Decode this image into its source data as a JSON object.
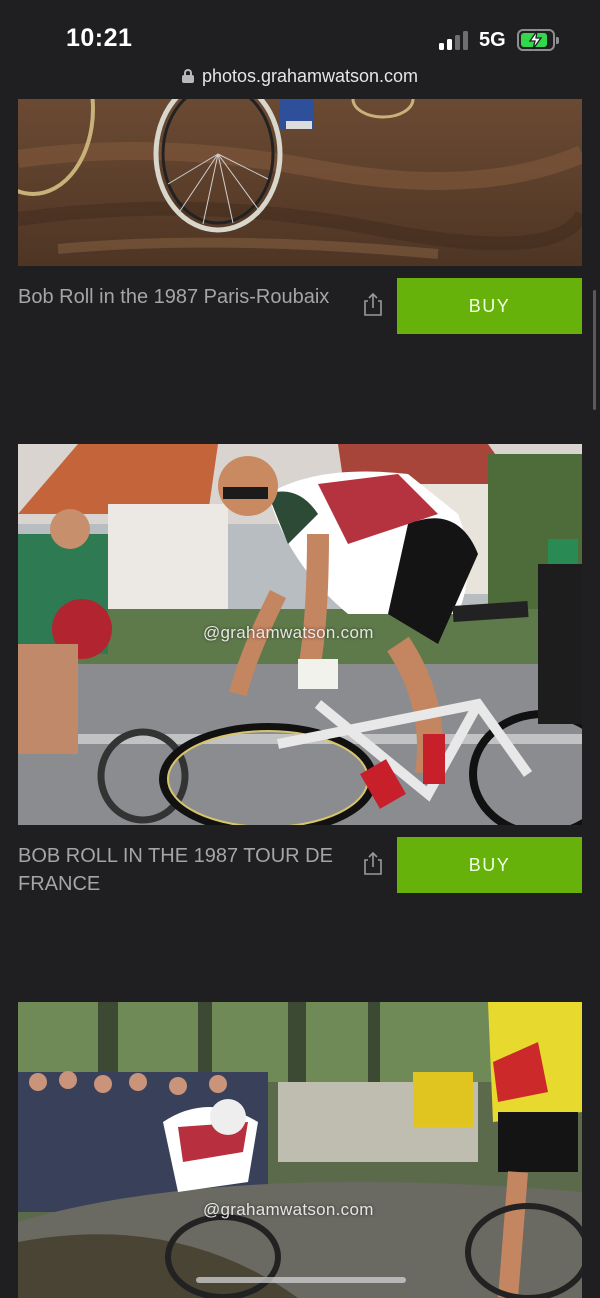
{
  "status_bar": {
    "time": "10:21",
    "network": "5G",
    "battery_charging": true
  },
  "browser": {
    "url": "photos.grahamwatson.com"
  },
  "photos": [
    {
      "caption": "Bob Roll in the 1987 Paris-Roubaix",
      "buy_label": "BUY",
      "watermark": ""
    },
    {
      "caption": "BOB ROLL IN THE 1987 TOUR DE FRANCE",
      "buy_label": "BUY",
      "watermark": "@grahamwatson.com"
    },
    {
      "caption": "",
      "buy_label": "",
      "watermark": "@grahamwatson.com"
    }
  ],
  "colors": {
    "background": "#1f1f21",
    "buy_button": "#66b10a",
    "caption_text": "#a5a5a8"
  },
  "icons": [
    "lock-icon",
    "share-icon",
    "battery-icon",
    "signal-icon"
  ]
}
